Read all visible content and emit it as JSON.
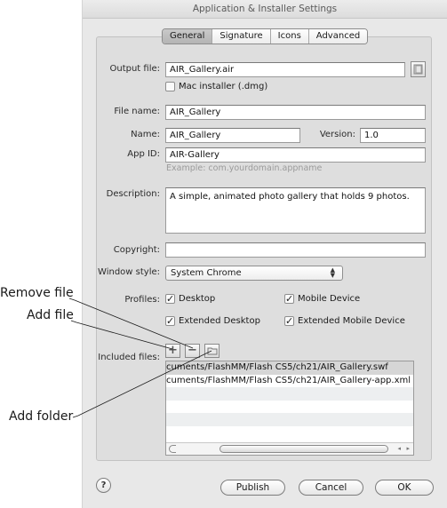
{
  "window": {
    "title": "Application & Installer Settings"
  },
  "tabs": [
    {
      "label": "General",
      "active": true
    },
    {
      "label": "Signature",
      "active": false
    },
    {
      "label": "Icons",
      "active": false
    },
    {
      "label": "Advanced",
      "active": false
    }
  ],
  "form": {
    "output_file": {
      "label": "Output file:",
      "value": "AIR_Gallery.air"
    },
    "mac_installer": {
      "label": "Mac installer (.dmg)",
      "checked": false
    },
    "file_name": {
      "label": "File name:",
      "value": "AIR_Gallery"
    },
    "name": {
      "label": "Name:",
      "value": "AIR_Gallery"
    },
    "version": {
      "label": "Version:",
      "value": "1.0"
    },
    "app_id": {
      "label": "App ID:",
      "value": "AIR-Gallery",
      "hint": "Example: com.yourdomain.appname"
    },
    "description": {
      "label": "Description:",
      "value": "A simple, animated photo gallery that holds 9 photos."
    },
    "copyright": {
      "label": "Copyright:",
      "value": ""
    },
    "window_style": {
      "label": "Window style:",
      "value": "System Chrome"
    },
    "profiles": {
      "label": "Profiles:",
      "items": [
        {
          "label": "Desktop",
          "checked": true
        },
        {
          "label": "Mobile Device",
          "checked": true
        },
        {
          "label": "Extended Desktop",
          "checked": true
        },
        {
          "label": "Extended Mobile Device",
          "checked": true
        }
      ]
    },
    "included_files": {
      "label": "Included files:",
      "files": [
        "cuments/FlashMM/Flash CS5/ch21/AIR_Gallery.swf",
        "cuments/FlashMM/Flash CS5/ch21/AIR_Gallery-app.xml"
      ]
    }
  },
  "icons": {
    "check": "✓",
    "add": "+",
    "remove": "−",
    "help": "?",
    "stepper_up": "▲",
    "stepper_down": "▼",
    "scroll_left": "◂",
    "scroll_right": "▸"
  },
  "buttons": {
    "publish": "Publish",
    "cancel": "Cancel",
    "ok": "OK"
  },
  "callouts": {
    "remove_file": "Remove file",
    "add_file": "Add file",
    "add_folder": "Add folder"
  }
}
